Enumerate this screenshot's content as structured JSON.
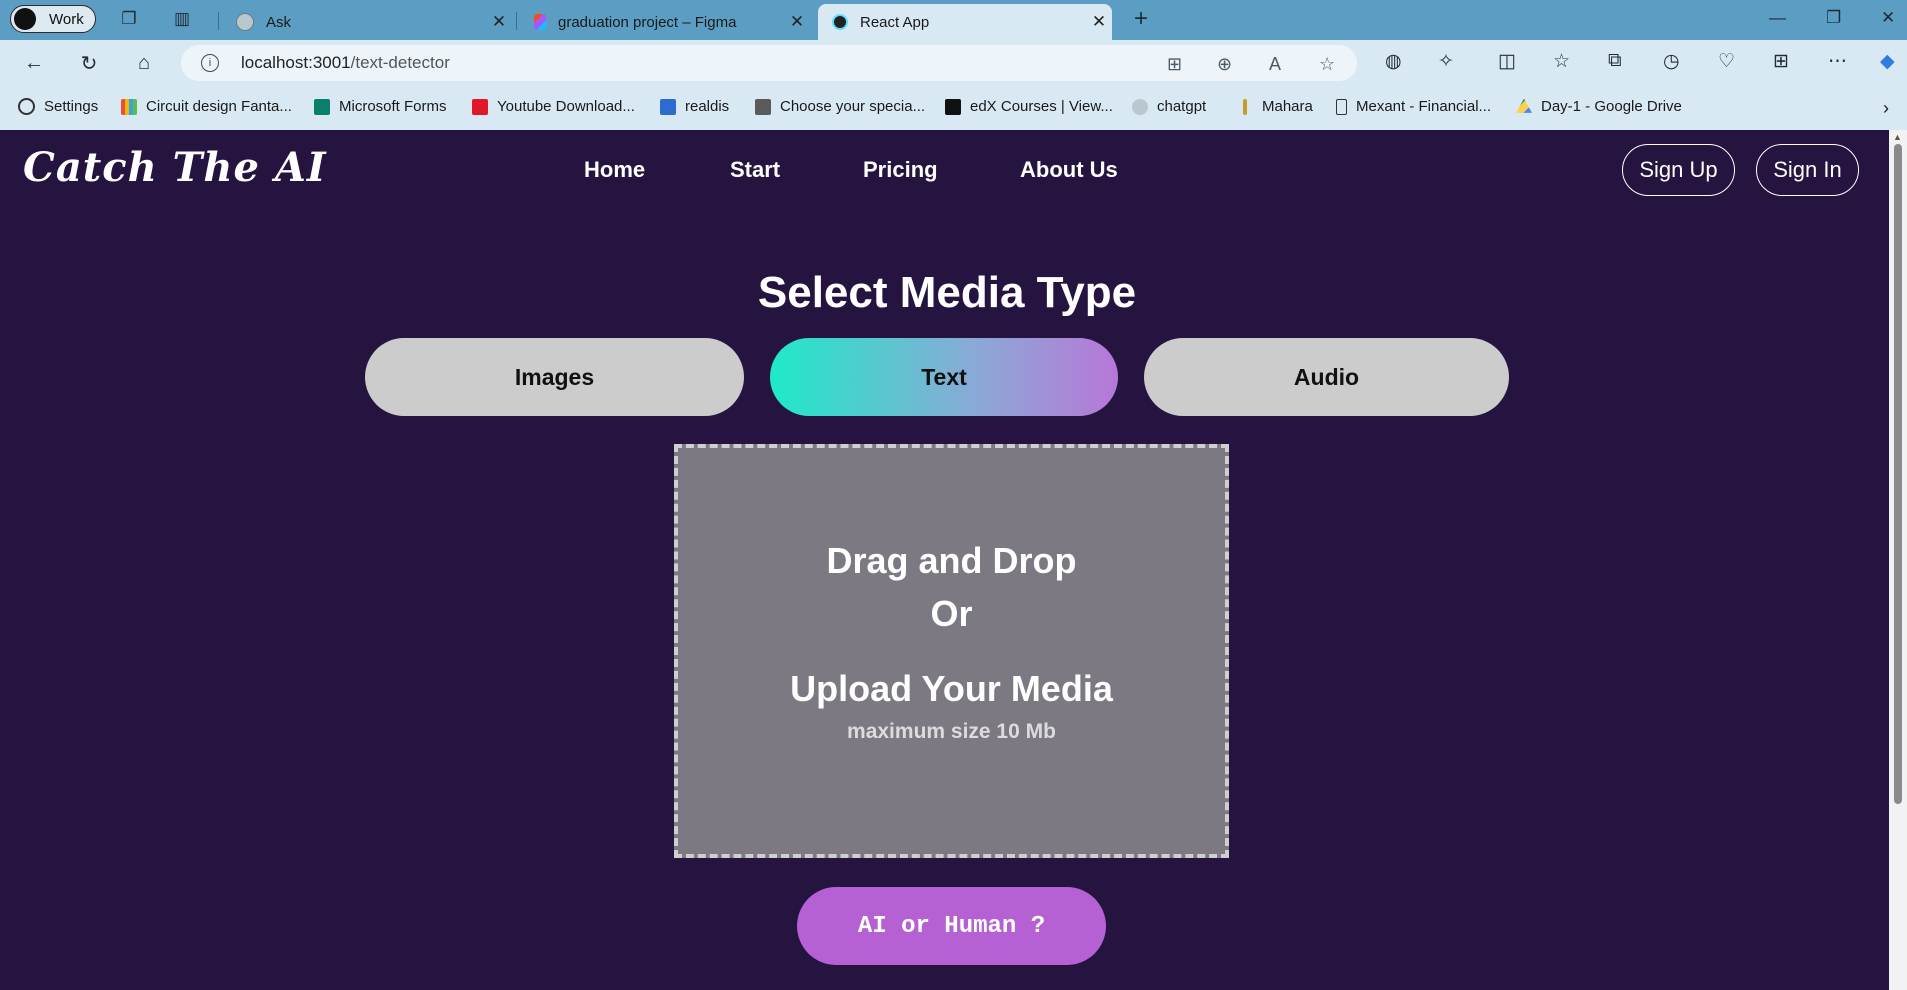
{
  "browser": {
    "profile_label": "Work",
    "tabs": [
      {
        "title": "Ask",
        "active": false
      },
      {
        "title": "graduation project – Figma",
        "active": false
      },
      {
        "title": "React App",
        "active": true
      }
    ],
    "url_host": "localhost:3001",
    "url_path": "/text-detector",
    "bookmarks": [
      {
        "label": "Settings",
        "icon": "gear-icon"
      },
      {
        "label": "Circuit design Fanta...",
        "icon": "tinkercad-icon"
      },
      {
        "label": "Microsoft Forms",
        "icon": "forms-icon"
      },
      {
        "label": "Youtube Download...",
        "icon": "download-icon"
      },
      {
        "label": "realdis",
        "icon": "rd-icon"
      },
      {
        "label": "Choose your specia...",
        "icon": "page-icon"
      },
      {
        "label": "edX Courses | View...",
        "icon": "edx-icon"
      },
      {
        "label": "chatgpt",
        "icon": "chatgpt-icon"
      },
      {
        "label": "Mahara",
        "icon": "mahara-icon"
      },
      {
        "label": "Mexant - Financial...",
        "icon": "doc-icon"
      },
      {
        "label": "Day-1 - Google Drive",
        "icon": "drive-icon"
      }
    ]
  },
  "site": {
    "logo": "Catch The AI",
    "nav": [
      "Home",
      "Start",
      "Pricing",
      "About Us"
    ],
    "sign_up": "Sign Up",
    "sign_in": "Sign In",
    "heading": "Select Media Type",
    "media_types": [
      {
        "label": "Images",
        "selected": false
      },
      {
        "label": "Text",
        "selected": true
      },
      {
        "label": "Audio",
        "selected": false
      }
    ],
    "dropzone": {
      "line1": "Drag and Drop",
      "line2": "Or",
      "line3": "Upload Your Media",
      "note": "maximum size 10 Mb"
    },
    "cta": "AI or Human ?"
  },
  "colors": {
    "page_bg": "#24143f",
    "tabbar_bg": "#5c9dc4",
    "toolbar_bg": "#d8e9f4",
    "inactive_pill": "#cccccc",
    "active_pill_gradient": [
      "#1eeac8",
      "#b777d8"
    ],
    "dropzone_bg": "#7d7982",
    "cta_bg": "#b561d3"
  }
}
